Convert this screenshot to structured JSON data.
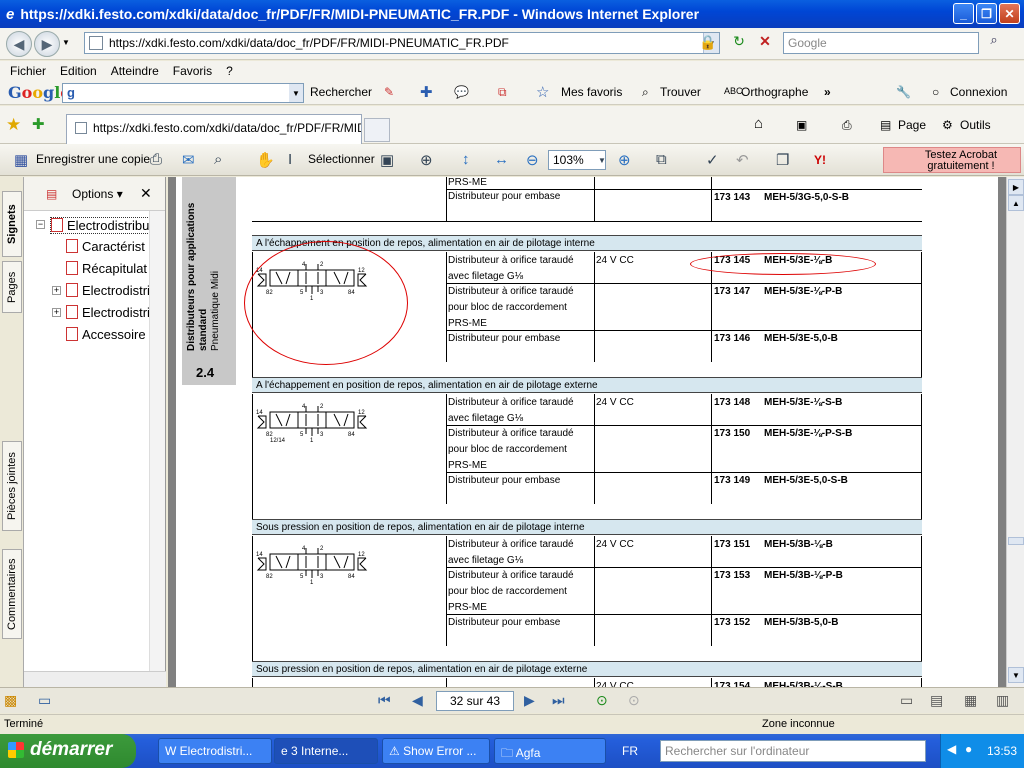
{
  "window": {
    "title": "https://xdki.festo.com/xdki/data/doc_fr/PDF/FR/MIDI-PNEUMATIC_FR.PDF - Windows Internet Explorer"
  },
  "address": {
    "url": "https://xdki.festo.com/xdki/data/doc_fr/PDF/FR/MIDI-PNEUMATIC_FR.PDF",
    "search_placeholder": "Google"
  },
  "menu": [
    "Fichier",
    "Edition",
    "Atteindre",
    "Favoris",
    "?"
  ],
  "google_toolbar": {
    "logo": "Google",
    "search_prefix": "g",
    "rechercher": "Rechercher",
    "mes_favoris": "Mes favoris",
    "trouver": "Trouver",
    "orthographe": "Orthographe",
    "connexion": "Connexion"
  },
  "tabs": {
    "active_tab": "https://xdki.festo.com/xdki/data/doc_fr/PDF/FR/MIDI...",
    "page_label": "Page",
    "outils_label": "Outils"
  },
  "acrobat": {
    "save_copy": "Enregistrer une copie",
    "select": "Sélectionner",
    "zoom": "103%",
    "promo": "Testez Acrobat gratuitement !"
  },
  "side_tabs": [
    "Signets",
    "Pages",
    "Pièces jointes",
    "Commentaires"
  ],
  "bookmarks": {
    "options": "Options",
    "items": [
      "Electrodistribu",
      "Caractérist",
      "Récapitulat",
      "Electrodistri",
      "Electrodistri",
      "Accessoire"
    ]
  },
  "document": {
    "side_title": "Distributeurs pour applications standard",
    "side_subtitle": "Pneumatique Midi",
    "section_num": "2.4",
    "top_rows": {
      "prs": "PRS-ME",
      "embase": "Distributeur pour embase",
      "code": "173 143",
      "ref": "MEH-5/3G-5,0-S-B"
    },
    "sections": [
      {
        "title": "A l'échappement en position de repos, alimentation en air de pilotage interne",
        "voltage": "24 V CC",
        "rows": [
          {
            "desc": [
              "Distributeur à orifice taraudé",
              "avec filetage G⅛"
            ],
            "code": "173 145",
            "ref": "MEH-5/3E-⅛-B"
          },
          {
            "desc": [
              "Distributeur à orifice taraudé",
              "pour bloc de raccordement",
              "PRS-ME"
            ],
            "code": "173 147",
            "ref": "MEH-5/3E-⅛-P-B"
          },
          {
            "desc": [
              "Distributeur pour embase"
            ],
            "code": "173 146",
            "ref": "MEH-5/3E-5,0-B"
          }
        ]
      },
      {
        "title": "A l'échappement en position de repos, alimentation en air de pilotage externe",
        "voltage": "24 V CC",
        "rows": [
          {
            "desc": [
              "Distributeur à orifice taraudé",
              "avec filetage G⅛"
            ],
            "code": "173 148",
            "ref": "MEH-5/3E-⅛-S-B"
          },
          {
            "desc": [
              "Distributeur à orifice taraudé",
              "pour bloc de raccordement",
              "PRS-ME"
            ],
            "code": "173 150",
            "ref": "MEH-5/3E-⅛-P-S-B"
          },
          {
            "desc": [
              "Distributeur pour embase"
            ],
            "code": "173 149",
            "ref": "MEH-5/3E-5,0-S-B"
          }
        ]
      },
      {
        "title": "Sous pression en position de repos, alimentation en air de pilotage interne",
        "voltage": "24 V CC",
        "rows": [
          {
            "desc": [
              "Distributeur à orifice taraudé",
              "avec filetage G⅛"
            ],
            "code": "173 151",
            "ref": "MEH-5/3B-⅛-B"
          },
          {
            "desc": [
              "Distributeur à orifice taraudé",
              "pour bloc de raccordement",
              "PRS-ME"
            ],
            "code": "173 153",
            "ref": "MEH-5/3B-⅛-P-B"
          },
          {
            "desc": [
              "Distributeur pour embase"
            ],
            "code": "173 152",
            "ref": "MEH-5/3B-5,0-B"
          }
        ]
      },
      {
        "title": "Sous pression en position de repos, alimentation en air de pilotage externe",
        "voltage": "24 V CC",
        "rows": [
          {
            "desc": [
              ""
            ],
            "code": "173 154",
            "ref": "MEH-5/3B-⅛-S-B"
          }
        ]
      }
    ],
    "schem_labels": {
      "p14": "14",
      "p12": "12",
      "p4": "4",
      "p2": "2",
      "p5": "5",
      "p1": "1",
      "p3": "3",
      "p82": "82",
      "p84": "84",
      "p1214": "12/14"
    }
  },
  "navigation": {
    "page_indicator": "32 sur 43"
  },
  "status": {
    "left": "Terminé",
    "zone": "Zone inconnue"
  },
  "taskbar": {
    "start": "démarrer",
    "buttons": [
      "Electrodistri...",
      "3 Interne...",
      "Show Error ...",
      "Agfa"
    ],
    "lang": "FR",
    "search_placeholder": "Rechercher sur l'ordinateur",
    "clock": "13:53"
  }
}
